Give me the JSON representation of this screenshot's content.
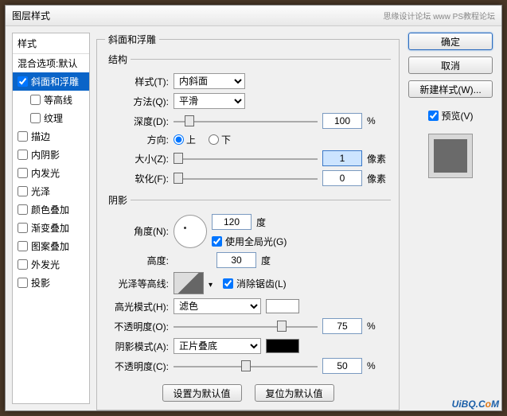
{
  "window": {
    "title": "图层样式",
    "watermark_top": "思缘设计论坛  www PS教程论坛"
  },
  "styles": {
    "header": "样式",
    "blend_default": "混合选项:默认",
    "bevel": "斜面和浮雕",
    "contour": "等高线",
    "texture": "纹理",
    "stroke": "描边",
    "inner_shadow": "内阴影",
    "inner_glow": "内发光",
    "satin": "光泽",
    "color_overlay": "颜色叠加",
    "gradient_overlay": "渐变叠加",
    "pattern_overlay": "图案叠加",
    "outer_glow": "外发光",
    "drop_shadow": "投影"
  },
  "bevel": {
    "section_title": "斜面和浮雕",
    "structure_title": "结构",
    "style_label": "样式(T):",
    "style_value": "内斜面",
    "technique_label": "方法(Q):",
    "technique_value": "平滑",
    "depth_label": "深度(D):",
    "depth_value": "100",
    "depth_unit": "%",
    "direction_label": "方向:",
    "dir_up": "上",
    "dir_down": "下",
    "size_label": "大小(Z):",
    "size_value": "1",
    "size_unit": "像素",
    "soften_label": "软化(F):",
    "soften_value": "0",
    "soften_unit": "像素"
  },
  "shading": {
    "title": "阴影",
    "angle_label": "角度(N):",
    "angle_value": "120",
    "angle_unit": "度",
    "global_light": "使用全局光(G)",
    "altitude_label": "高度:",
    "altitude_value": "30",
    "altitude_unit": "度",
    "gloss_label": "光泽等高线:",
    "antialias": "消除锯齿(L)",
    "highlight_mode_label": "高光模式(H):",
    "highlight_mode_value": "滤色",
    "highlight_opacity_label": "不透明度(O):",
    "highlight_opacity_value": "75",
    "opacity_unit": "%",
    "shadow_mode_label": "阴影模式(A):",
    "shadow_mode_value": "正片叠底",
    "shadow_opacity_label": "不透明度(C):",
    "shadow_opacity_value": "50"
  },
  "bottom": {
    "make_default": "设置为默认值",
    "reset_default": "复位为默认值"
  },
  "right": {
    "ok": "确定",
    "cancel": "取消",
    "new_style": "新建样式(W)...",
    "preview": "预览(V)"
  },
  "logo": {
    "p1": "UiBQ.C",
    "p2": "o",
    "p3": "M"
  }
}
